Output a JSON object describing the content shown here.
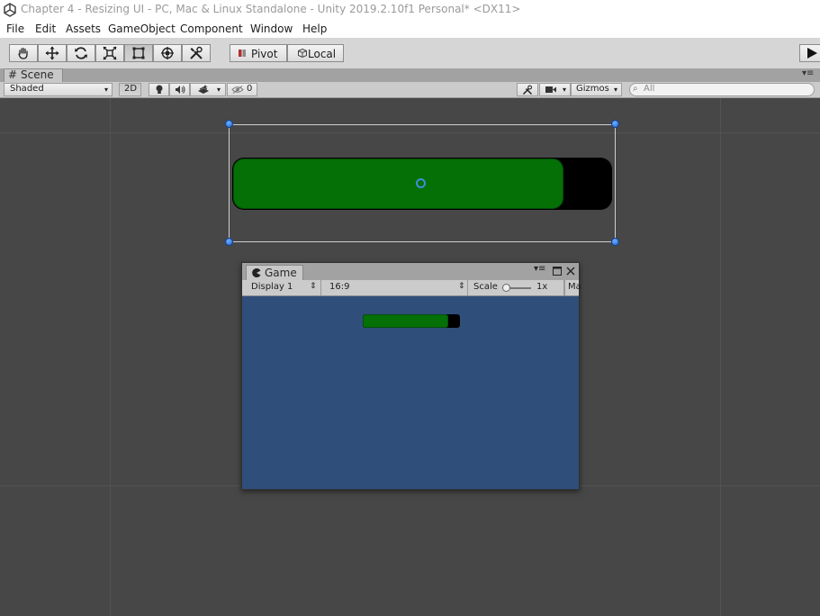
{
  "window": {
    "title": "Chapter 4 - Resizing UI - PC, Mac & Linux Standalone - Unity 2019.2.10f1 Personal* <DX11>",
    "logo_icon": "unity-logo-icon"
  },
  "menubar": {
    "items": [
      "File",
      "Edit",
      "Assets",
      "GameObject",
      "Component",
      "Window",
      "Help"
    ]
  },
  "toolbar": {
    "tools": [
      {
        "name": "hand-tool",
        "icon": "hand-icon"
      },
      {
        "name": "move-tool",
        "icon": "move-icon"
      },
      {
        "name": "rotate-tool",
        "icon": "rotate-icon"
      },
      {
        "name": "scale-tool",
        "icon": "scale-icon"
      },
      {
        "name": "rect-tool",
        "icon": "rect-icon",
        "active": true
      },
      {
        "name": "transform-tool",
        "icon": "transform-icon"
      },
      {
        "name": "custom-tool",
        "icon": "tools-icon"
      }
    ],
    "pivot_label": "Pivot",
    "local_label": "Local",
    "play_icon": "play-icon"
  },
  "scene": {
    "tab_label": "Scene",
    "shading_mode": "Shaded",
    "mode_2d": "2D",
    "hidden_count": "0",
    "gizmos_label": "Gizmos",
    "search_placeholder": "All"
  },
  "health_bar": {
    "fill_fraction": 0.87,
    "fill_color": "#047006",
    "background_color": "#000000"
  },
  "game": {
    "tab_label": "Game",
    "display": "Display 1",
    "aspect": "16:9",
    "scale_label": "Scale",
    "scale_value": "1x",
    "maximize_label": "Ma",
    "background_color": "#2f4e7a"
  }
}
